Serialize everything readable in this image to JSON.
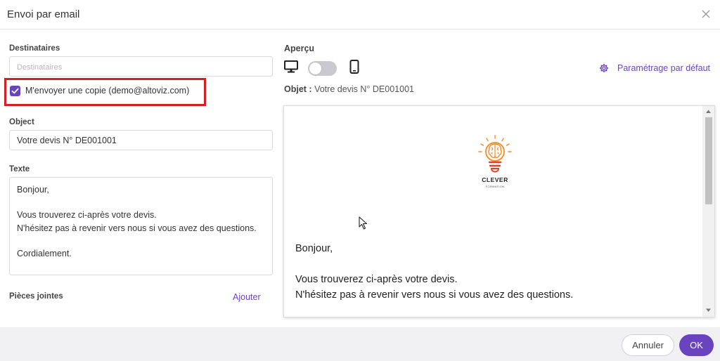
{
  "dialog": {
    "title": "Envoi par email"
  },
  "form": {
    "recipients_label": "Destinataires",
    "recipients_placeholder": "Destinataires",
    "recipients_value": "",
    "copy_label": "M'envoyer une copie (demo@altoviz.com)",
    "copy_checked": true,
    "subject_label": "Object",
    "subject_value": "Votre devis N° DE001001",
    "body_label": "Texte",
    "body_value": "Bonjour,\n\nVous trouverez ci-après votre devis.\nN'hésitez pas à revenir vers nous si vous avez des questions.\n\nCordialement.",
    "attachments_label": "Pièces jointes",
    "add_label": "Ajouter"
  },
  "preview": {
    "label": "Aperçu",
    "settings_label": "Paramétrage par défaut",
    "subject_prefix": "Objet :",
    "subject_text": "Votre devis N° DE001001",
    "logo_name": "CLEVER",
    "logo_sub": "FORMATION",
    "body_line1": "Bonjour,",
    "body_line2": "Vous trouverez ci-après votre devis.",
    "body_line3": "N'hésitez pas à revenir vers nous si vous avez des questions.",
    "scrollbar_position": 0
  },
  "footer": {
    "cancel_label": "Annuler",
    "ok_label": "OK"
  },
  "colors": {
    "accent": "#6a44bf",
    "highlight": "#d31f26",
    "logo_orange": "#f08a24",
    "logo_red": "#e2402f"
  },
  "icons": [
    "close-icon",
    "check-icon",
    "desktop-icon",
    "mobile-icon",
    "gear-icon",
    "cursor-icon"
  ]
}
